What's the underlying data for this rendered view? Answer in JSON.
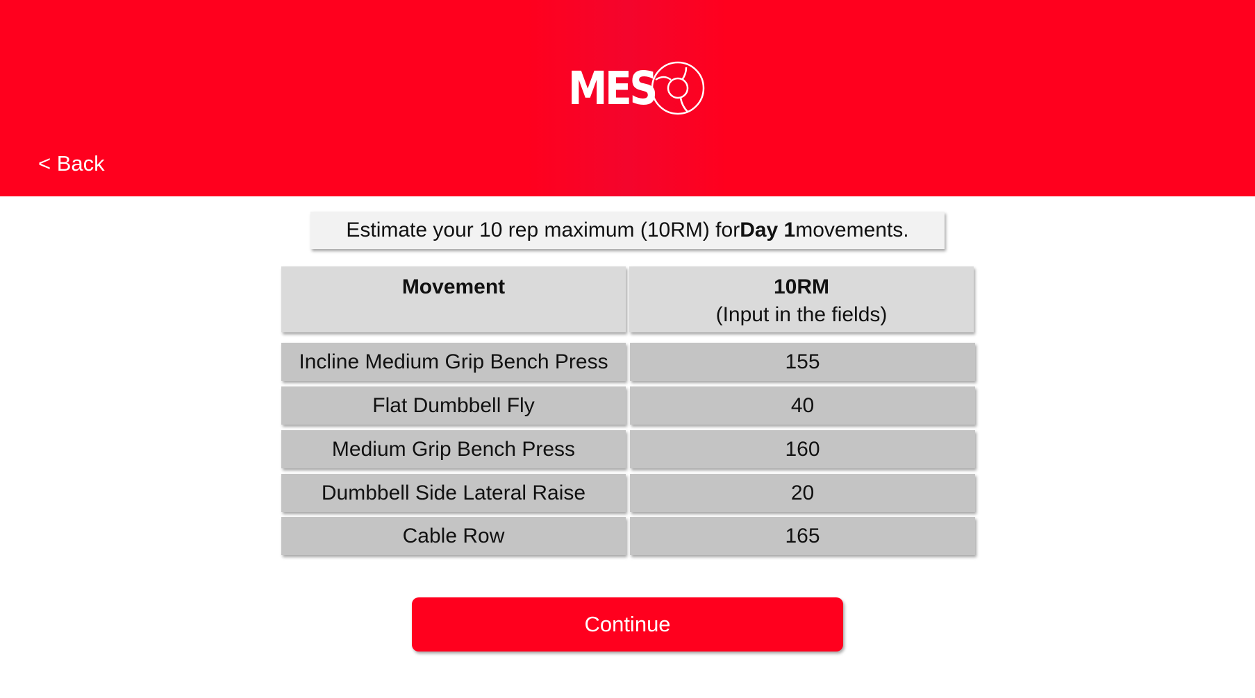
{
  "header": {
    "logo_text": "MES",
    "back_label": "< Back",
    "bg_color": "#ff001e"
  },
  "prompt": {
    "text_before": "Estimate your 10 rep maximum (10RM) for ",
    "text_bold": "Day 1",
    "text_after": " movements."
  },
  "table": {
    "col_movement": "Movement",
    "col_rm_title": "10RM",
    "col_rm_subtitle": "(Input in the fields)",
    "rows": [
      {
        "movement": "Incline Medium Grip Bench Press",
        "value": "155"
      },
      {
        "movement": "Flat Dumbbell Fly",
        "value": "40"
      },
      {
        "movement": "Medium Grip Bench Press",
        "value": "160"
      },
      {
        "movement": "Dumbbell Side Lateral Raise",
        "value": "20"
      },
      {
        "movement": "Cable Row",
        "value": "165"
      }
    ]
  },
  "continue_label": "Continue",
  "accent_color": "#ff001e"
}
